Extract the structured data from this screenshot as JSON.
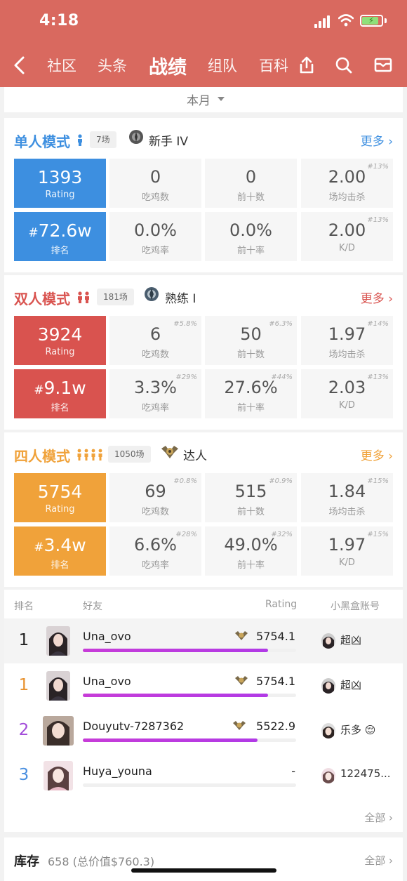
{
  "status_bar": {
    "time": "4:18"
  },
  "nav": {
    "tabs": [
      {
        "label": "社区"
      },
      {
        "label": "头条"
      },
      {
        "label": "战绩",
        "active": true
      },
      {
        "label": "组队"
      },
      {
        "label": "百科"
      }
    ],
    "icons": [
      "back-icon",
      "share-icon",
      "search-icon",
      "mail-icon"
    ]
  },
  "filter": {
    "period": "本月"
  },
  "modes": [
    {
      "title": "单人模式",
      "count": "7场",
      "rank": "新手 IV",
      "more": "更多 ›",
      "color": "#3d8fe0",
      "rating": {
        "value": "1393",
        "label": "Rating"
      },
      "ranking": {
        "prefix": "#",
        "value": "72.6w",
        "label": "排名"
      },
      "stats": [
        {
          "value": "0",
          "label": "吃鸡数",
          "pct": ""
        },
        {
          "value": "0",
          "label": "前十数",
          "pct": ""
        },
        {
          "value": "2.00",
          "label": "场均击杀",
          "pct": "#13%"
        },
        {
          "value": "0.0%",
          "label": "吃鸡率",
          "pct": ""
        },
        {
          "value": "0.0%",
          "label": "前十率",
          "pct": ""
        },
        {
          "value": "2.00",
          "label": "K/D",
          "pct": "#13%"
        }
      ]
    },
    {
      "title": "双人模式",
      "count": "181场",
      "rank": "熟练 I",
      "more": "更多 ›",
      "color": "#d9534f",
      "rating": {
        "value": "3924",
        "label": "Rating"
      },
      "ranking": {
        "prefix": "#",
        "value": "9.1w",
        "label": "排名"
      },
      "stats": [
        {
          "value": "6",
          "label": "吃鸡数",
          "pct": "#5.8%"
        },
        {
          "value": "50",
          "label": "前十数",
          "pct": "#6.3%"
        },
        {
          "value": "1.97",
          "label": "场均击杀",
          "pct": "#14%"
        },
        {
          "value": "3.3%",
          "label": "吃鸡率",
          "pct": "#29%"
        },
        {
          "value": "27.6%",
          "label": "前十率",
          "pct": "#44%"
        },
        {
          "value": "2.03",
          "label": "K/D",
          "pct": "#13%"
        }
      ]
    },
    {
      "title": "四人模式",
      "count": "1050场",
      "rank": "达人",
      "more": "更多 ›",
      "color": "#f0a23a",
      "rating": {
        "value": "5754",
        "label": "Rating"
      },
      "ranking": {
        "prefix": "#",
        "value": "3.4w",
        "label": "排名"
      },
      "stats": [
        {
          "value": "69",
          "label": "吃鸡数",
          "pct": "#0.8%"
        },
        {
          "value": "515",
          "label": "前十数",
          "pct": "#0.9%"
        },
        {
          "value": "1.84",
          "label": "场均击杀",
          "pct": "#15%"
        },
        {
          "value": "6.6%",
          "label": "吃鸡率",
          "pct": "#28%"
        },
        {
          "value": "49.0%",
          "label": "前十率",
          "pct": "#32%"
        },
        {
          "value": "1.97",
          "label": "K/D",
          "pct": "#15%"
        }
      ]
    }
  ],
  "friends": {
    "headers": {
      "rank": "排名",
      "friend": "好友",
      "rating": "Rating",
      "account": "小黑盒账号"
    },
    "rows": [
      {
        "rank": "1",
        "rank_color": "#222",
        "name": "Una_ovo",
        "rating": "5754.1",
        "progress": 0.87,
        "account": "超凶",
        "highlight": true
      },
      {
        "rank": "1",
        "rank_color": "#e8922f",
        "name": "Una_ovo",
        "rating": "5754.1",
        "progress": 0.87,
        "account": "超凶",
        "highlight": false
      },
      {
        "rank": "2",
        "rank_color": "#a24bd9",
        "name": "Douyutv-7287362",
        "rating": "5522.9",
        "progress": 0.82,
        "account": "乐多 😌",
        "highlight": false
      },
      {
        "rank": "3",
        "rank_color": "#4a8fe0",
        "name": "Huya_youna",
        "rating": "-",
        "progress": 0,
        "account": "122475...",
        "highlight": false
      }
    ],
    "all_link": "全部 ›"
  },
  "inventory": {
    "title": "库存",
    "summary": "658 (总价值$760.3)",
    "all_link": "全部 ›"
  }
}
